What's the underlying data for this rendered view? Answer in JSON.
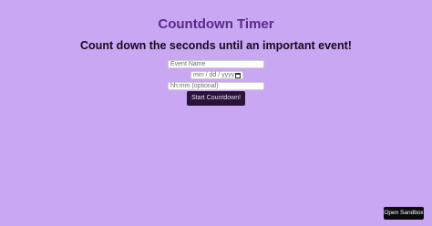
{
  "page": {
    "title": "Countdown Timer",
    "subtitle": "Count down the seconds until an important event!"
  },
  "form": {
    "event_name_placeholder": "Event Name",
    "date_placeholder": "mm / dd / yyyy",
    "time_placeholder": "hh:mm (optional)",
    "start_button_label": "Start Countdown!"
  },
  "footer": {
    "open_sandbox_label": "Open Sandbox"
  },
  "icons": {
    "date_field_icon": "calendar-icon"
  },
  "colors": {
    "background": "#c9a7f2",
    "title": "#5a2a86",
    "button": "#2a1438",
    "sandbox_button": "#0b0b0f"
  }
}
